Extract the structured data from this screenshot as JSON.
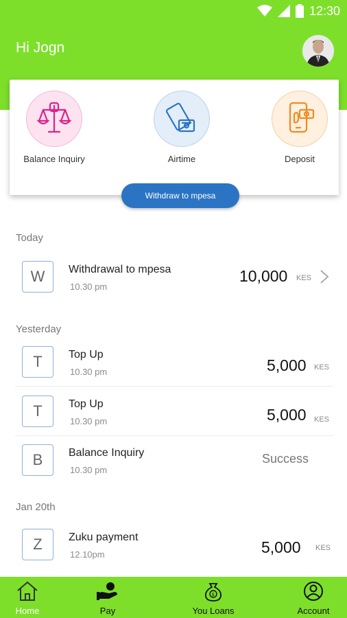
{
  "status_bar": {
    "time": "12:30"
  },
  "header": {
    "greeting": "Hi Jogn"
  },
  "services": [
    {
      "label": "Balance Inquiry",
      "icon": "scales-icon",
      "color": "#e0208a",
      "bg": "#fde3f0"
    },
    {
      "label": "Airtime",
      "icon": "phone-card-icon",
      "color": "#2b74c3",
      "bg": "#e3eef9"
    },
    {
      "label": "Deposit",
      "icon": "mobile-money-icon",
      "color": "#f18a1e",
      "bg": "#fff0e0"
    }
  ],
  "withdraw_button": {
    "label": "Withdraw to mpesa"
  },
  "sections": {
    "today": "Today",
    "yesterday": "Yesterday",
    "jan20": "Jan 20th"
  },
  "transactions": [
    {
      "letter": "W",
      "title": "Withdrawal to mpesa",
      "time": "10.30 pm",
      "amount": "10,000",
      "unit": "KES"
    },
    {
      "letter": "T",
      "title": "Top Up",
      "time": "10.30 pm",
      "amount": "5,000",
      "unit": "KES"
    },
    {
      "letter": "T",
      "title": "Top Up",
      "time": "10.30 pm",
      "amount": "5,000",
      "unit": "KES"
    },
    {
      "letter": "B",
      "title": "Balance Inquiry",
      "time": "10.30 pm",
      "status": "Success"
    },
    {
      "letter": "Z",
      "title": "Zuku payment",
      "time": "12.10pm",
      "amount": "5,000",
      "unit": "KES"
    }
  ],
  "bottom_nav": [
    {
      "label": "Home",
      "icon": "home-icon"
    },
    {
      "label": "Pay",
      "icon": "pay-icon"
    },
    {
      "label": "You Loans",
      "icon": "money-bag-icon"
    },
    {
      "label": "Account",
      "icon": "user-icon"
    }
  ],
  "colors": {
    "primary_green": "#7ddf2a",
    "button_blue": "#2b74c3"
  }
}
